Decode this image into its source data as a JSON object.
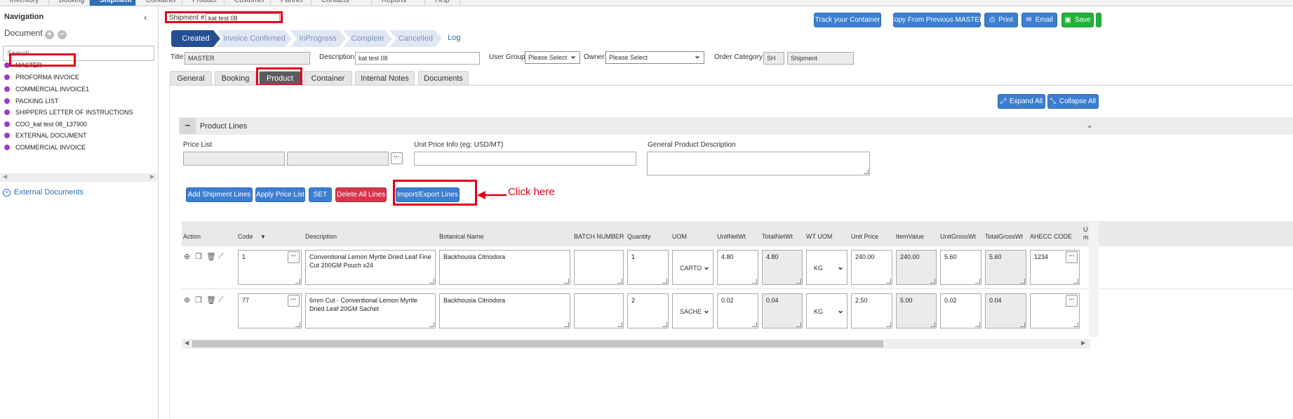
{
  "topnav": [
    "Inventory",
    "Booking",
    "Shipment",
    "Container",
    "Product",
    "Customer",
    "Partner",
    "Contacts",
    "Reports",
    "Help"
  ],
  "topnav_active": "Shipment",
  "sidebar": {
    "title": "Navigation",
    "document_label": "Document",
    "search_placeholder": "Search",
    "documents": [
      "MASTER",
      "PROFORMA INVOICE",
      "COMMERCIAL INVOICE1",
      "PACKING LIST",
      "SHIPPERS LETTER OF INSTRUCTIONS",
      "COO_kat test 08_137900",
      "EXTERNAL DOCUMENT",
      "COMMERCIAL INVOICE"
    ],
    "external_documents": "External Documents"
  },
  "header": {
    "shipment_label": "Shipment #:",
    "shipment_value": "kat test 08",
    "buttons": {
      "track": "Track your Container",
      "copy": "Copy From Previous MASTER",
      "print": "Print",
      "email": "Email",
      "save": "Save"
    }
  },
  "workflow": {
    "steps": [
      "Created",
      "Invoice Confirmed",
      "InProgress",
      "Complete",
      "Cancelled"
    ],
    "log": "Log"
  },
  "form": {
    "title_label": "Title:",
    "title_value": "MASTER",
    "description_label": "Description:",
    "description_value": "kat test 08",
    "user_group_label": "User Group:",
    "user_group_value": "Please Select",
    "owner_label": "Owner:",
    "owner_value": "Please Select",
    "order_category_label": "Order Category:",
    "order_category_code": "SH",
    "order_category_value": "Shipment"
  },
  "tabs": [
    "General",
    "Booking",
    "Product",
    "Container",
    "Internal Notes",
    "Documents"
  ],
  "active_tab": "Product",
  "panel": {
    "expand_all": "Expand All",
    "collapse_all": "Collapse All",
    "section_title": "Product Lines",
    "price_list_label": "Price List",
    "unit_price_label": "Unit Price Info (eg: USD/MT)",
    "general_desc_label": "General Product Description",
    "actions": {
      "add_lines": "Add Shipment Lines",
      "apply_price": "Apply Price List",
      "set": "SET",
      "delete_all": "Delete All Lines",
      "import_export": "Import/Export Lines"
    },
    "annotation": "Click here"
  },
  "table": {
    "columns": [
      "Action",
      "Code",
      "Description",
      "Botanical Name",
      "BATCH NUMBER",
      "Quantity",
      "UOM",
      "UnitNetWt",
      "TotalNetWt",
      "WT UOM",
      "Unit Price",
      "ItemValue",
      "UnitGrossWt",
      "TotalGrossWt",
      "AHECC CODE",
      "U m"
    ],
    "rows": [
      {
        "code": "1",
        "description": "Conventional Lemon Myrtle Dried Leaf Fine Cut 200GM Pouch x24",
        "botanical": "Backhousia Citriodora",
        "batch": "",
        "quantity": "1",
        "uom": "CARTO",
        "unit_net": "4.80",
        "total_net": "4.80",
        "wt_uom": "KG",
        "unit_price": "240.00",
        "item_value": "240.00",
        "unit_gross": "5.60",
        "total_gross": "5.60",
        "ahecc": "1234"
      },
      {
        "code": "77",
        "description": "6mm Cut - Conventional Lemon Myrtle Dried Leaf 20GM Sachet",
        "botanical": "Backhousia Citriodora",
        "batch": "",
        "quantity": "2",
        "uom": "SACHE",
        "unit_net": "0.02",
        "total_net": "0.04",
        "wt_uom": "KG",
        "unit_price": "2.50",
        "item_value": "5.00",
        "unit_gross": "0.02",
        "total_gross": "0.04",
        "ahecc": ""
      }
    ]
  }
}
